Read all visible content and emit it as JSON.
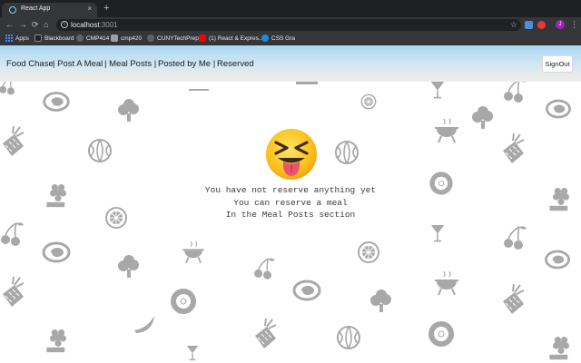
{
  "browser": {
    "tab_title": "React App",
    "tab_close": "×",
    "new_tab": "+",
    "url_host": "localhost",
    "url_port": ":3001",
    "avatar_letter": "J",
    "back": "←",
    "forward": "→",
    "reload": "⟳",
    "home": "⌂",
    "star": "☆",
    "menu": "⋮"
  },
  "bookmarks": [
    {
      "label": "Apps",
      "color": "#4285f4"
    },
    {
      "label": "Blackboard",
      "color": "#222222"
    },
    {
      "label": "CMP414",
      "color": "#5f6368"
    },
    {
      "label": "cmp420",
      "color": "#5f6368"
    },
    {
      "label": "CUNYTechPrep",
      "color": "#5f6368"
    },
    {
      "label": "(1) React & Expres...",
      "color": "#ff0000"
    },
    {
      "label": "CSS Gra",
      "color": "#1e88e5"
    }
  ],
  "nav": {
    "brand": "Food Chase",
    "post_meal": "| Post A Meal",
    "meal_posts": "| Meal Posts |",
    "posted_by_me": "Posted by Me |",
    "reserved": "Reserved",
    "signout": "SignOut"
  },
  "empty_state": {
    "emoji_icon": "squinting-face-tongue-icon",
    "line1": "You have not reserve anything yet",
    "line2": "You can reserve a meal",
    "line3": "In the Meal Posts section"
  },
  "colors": {
    "icon_gray": "#a8a8a8",
    "nav_top": "#a9d6f1",
    "nav_bottom": "#f3ece6",
    "chrome_dark": "#35363a",
    "text": "#3a3a3a"
  }
}
